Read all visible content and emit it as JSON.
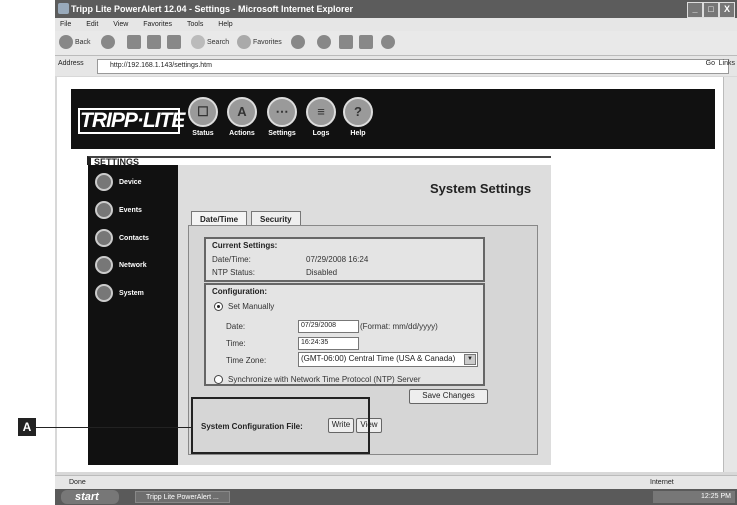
{
  "window": {
    "title": "Tripp Lite PowerAlert 12.04 - Settings - Microsoft Internet Explorer",
    "minimize": "_",
    "maximize": "□",
    "close": "X"
  },
  "menubar": [
    "File",
    "Edit",
    "View",
    "Favorites",
    "Tools",
    "Help"
  ],
  "toolbar": {
    "back": "Back",
    "search": "Search",
    "favorites": "Favorites"
  },
  "addressbar": {
    "label": "Address",
    "url": "http://192.168.1.143/settings.htm",
    "go": "Go",
    "links": "Links"
  },
  "brand": {
    "logo": "TRIPP·LITE"
  },
  "topnav": [
    {
      "label": "Status",
      "icon": "status-icon"
    },
    {
      "label": "Actions",
      "icon": "actions-icon"
    },
    {
      "label": "Settings",
      "icon": "settings-icon"
    },
    {
      "label": "Logs",
      "icon": "logs-icon"
    },
    {
      "label": "Help",
      "icon": "help-icon"
    }
  ],
  "section_label": "SETTINGS",
  "sidebar": [
    {
      "label": "Device"
    },
    {
      "label": "Events"
    },
    {
      "label": "Contacts"
    },
    {
      "label": "Network"
    },
    {
      "label": "System"
    }
  ],
  "main": {
    "title": "System Settings",
    "tabs": [
      "Date/Time",
      "Security"
    ],
    "current": {
      "heading": "Current Settings:",
      "datetime_label": "Date/Time:",
      "datetime_value": "07/29/2008  16:24",
      "ntp_label": "NTP Status:",
      "ntp_value": "Disabled"
    },
    "config": {
      "heading": "Configuration:",
      "set_manually": "Set Manually",
      "date_label": "Date:",
      "date_value": "07/29/2008",
      "date_format": "(Format: mm/dd/yyyy)",
      "time_label": "Time:",
      "time_value": "16:24:35",
      "tz_label": "Time Zone:",
      "tz_value": "(GMT-06:00) Central Time (USA & Canada)",
      "ntp_option": "Synchronize with Network Time Protocol (NTP) Server"
    },
    "save_label": "Save Changes",
    "sysconfig_label": "System Configuration File:",
    "write_label": "Write",
    "view_label": "View"
  },
  "callout": {
    "letter": "A"
  },
  "statusbar": {
    "left": "Done",
    "zone": "Internet"
  },
  "taskbar": {
    "start": "start",
    "task": "Tripp Lite PowerAlert ...",
    "time": "12:25 PM"
  },
  "colors": {
    "header_bg": "#111111",
    "content_bg": "#dddddd",
    "titlebar": "#5c5c5c"
  }
}
